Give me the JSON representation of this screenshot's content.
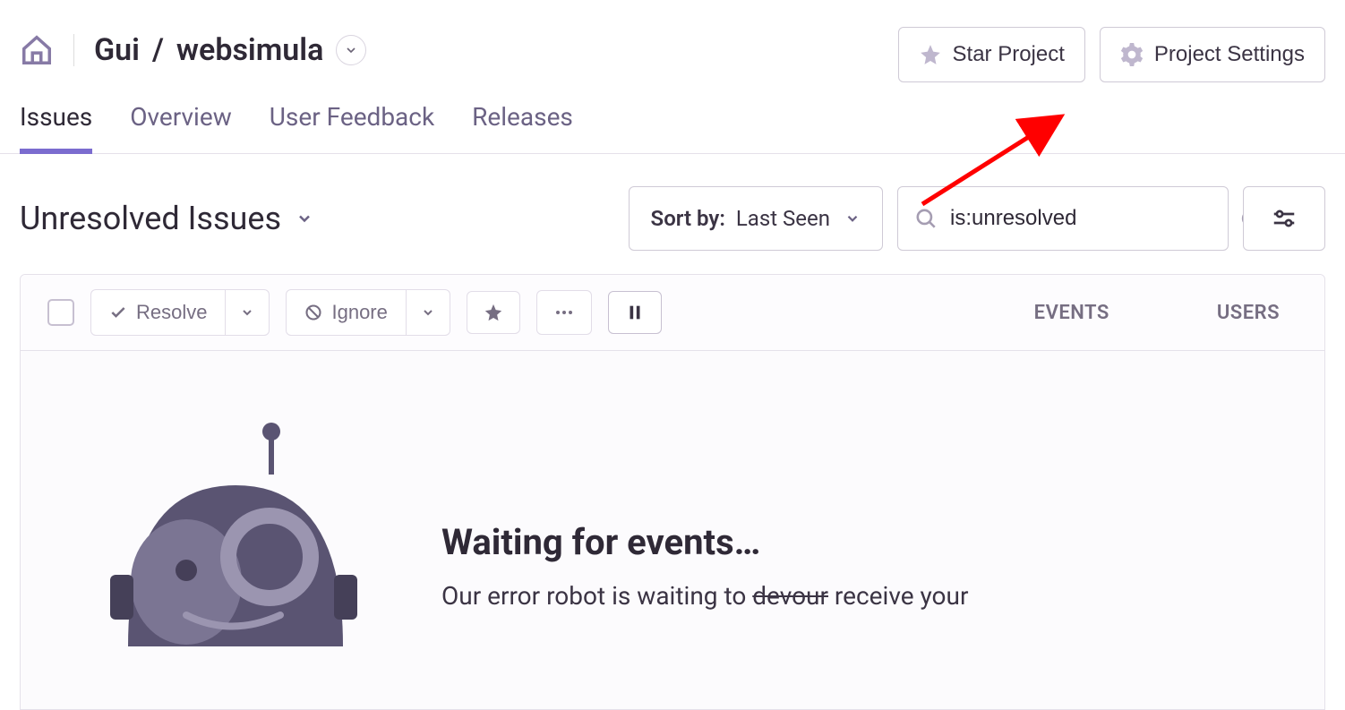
{
  "breadcrumb": {
    "org": "Gui",
    "project": "websimula"
  },
  "header_buttons": {
    "star": "Star Project",
    "settings": "Project Settings"
  },
  "nav": {
    "issues": "Issues",
    "overview": "Overview",
    "feedback": "User Feedback",
    "releases": "Releases"
  },
  "filter": {
    "title": "Unresolved Issues",
    "sort_label": "Sort by:",
    "sort_value": "Last Seen",
    "search_value": "is:unresolved"
  },
  "toolbar": {
    "resolve": "Resolve",
    "ignore": "Ignore",
    "columns": {
      "events": "EVENTS",
      "users": "USERS"
    }
  },
  "empty": {
    "title": "Waiting for events…",
    "sub_pre": "Our error robot is waiting to ",
    "sub_strike": "devour",
    "sub_post": " receive your"
  }
}
